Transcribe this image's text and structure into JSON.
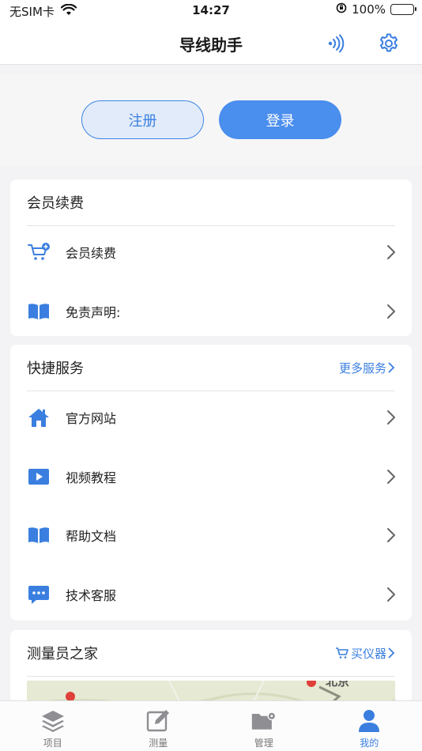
{
  "status_bar": {
    "carrier": "无SIM卡",
    "time": "14:27",
    "battery": "100%"
  },
  "nav": {
    "title": "导线助手"
  },
  "auth": {
    "register_label": "注册",
    "login_label": "登录"
  },
  "membership": {
    "title": "会员续费",
    "items": [
      {
        "label": "会员续费",
        "icon": "cart-plus-icon"
      },
      {
        "label": "免责声明:",
        "icon": "book-icon"
      }
    ]
  },
  "quick_services": {
    "title": "快捷服务",
    "more_label": "更多服务",
    "items": [
      {
        "label": "官方网站",
        "icon": "home-icon"
      },
      {
        "label": "视频教程",
        "icon": "video-icon"
      },
      {
        "label": "帮助文档",
        "icon": "book-icon"
      },
      {
        "label": "技术客服",
        "icon": "chat-icon"
      }
    ]
  },
  "surveyor_home": {
    "title": "测量员之家",
    "buy_label": "买仪器",
    "map_label": "北京"
  },
  "tabs": [
    {
      "label": "项目",
      "icon": "layers-icon",
      "active": false
    },
    {
      "label": "测量",
      "icon": "edit-icon",
      "active": false
    },
    {
      "label": "管理",
      "icon": "folder-gear-icon",
      "active": false
    },
    {
      "label": "我的",
      "icon": "user-icon",
      "active": true
    }
  ],
  "colors": {
    "accent": "#4a8eee",
    "text_link": "#3a7fe0",
    "icon_gray": "#8e8e93"
  }
}
